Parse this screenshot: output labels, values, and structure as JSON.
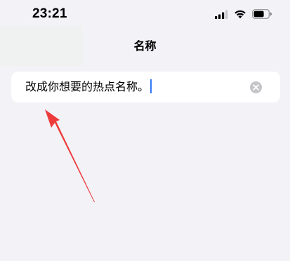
{
  "status_bar": {
    "time": "23:21",
    "icons": [
      "cellular-signal-icon",
      "wifi-icon",
      "battery-icon"
    ]
  },
  "nav": {
    "title": "名称"
  },
  "name_field": {
    "value": "改成你想要的热点名称。",
    "clear_icon": "clear-circle-icon"
  },
  "colors": {
    "background": "#f2f2f7",
    "card": "#ffffff",
    "caret": "#3478f6",
    "annotation_arrow": "#ee3b3b"
  }
}
